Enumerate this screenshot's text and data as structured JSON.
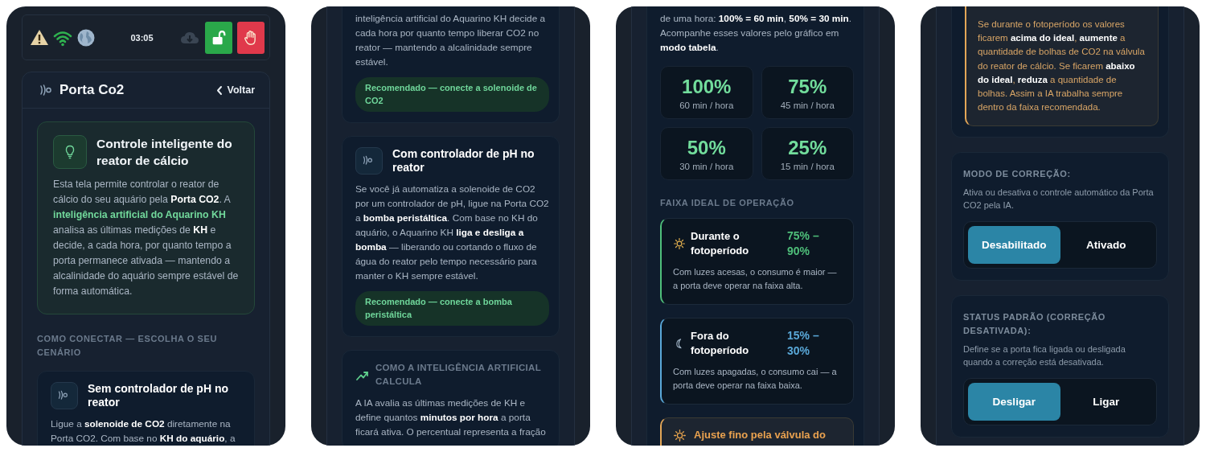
{
  "screens": [
    {
      "status_bar": {
        "time": "03:05"
      },
      "header": {
        "title": "Porta Co2",
        "back_label": "Voltar"
      },
      "blocks": [
        {
          "kind": "intro",
          "title": "Controle inteligente do reator de cálcio",
          "text_parts": [
            {
              "text": "Esta tela permite controlar o reator de cálcio do seu aquário pela ",
              "kind": "plain"
            },
            {
              "text": "Porta CO2",
              "kind": "strong"
            },
            {
              "text": ". A ",
              "kind": "plain"
            },
            {
              "text": "inteligência artificial do Aquarino KH",
              "kind": "highlight"
            },
            {
              "text": " analisa as últimas medições de ",
              "kind": "plain"
            },
            {
              "text": "KH",
              "kind": "strong"
            },
            {
              "text": " e decide, a cada hora, por quanto tempo a porta permanece ativada — mantendo a alcalinidade do aquário sempre estável de forma automática.",
              "kind": "plain"
            }
          ]
        },
        {
          "kind": "label",
          "text": "COMO CONECTAR — ESCOLHA O SEU CENÁRIO"
        },
        {
          "kind": "scenario",
          "continued": false,
          "title": "Sem controlador de pH no reator",
          "text": "Ligue a **solenoide de CO2** diretamente na Porta CO2. Com base no **KH do aquário**, a"
        }
      ]
    },
    {
      "blocks": [
        {
          "kind": "scenario",
          "continued": true,
          "text": "inteligência artificial do Aquarino KH decide a cada hora por quanto tempo liberar CO2 no reator — mantendo a alcalinidade sempre estável.",
          "badge": "Recomendado — conecte a solenoide de CO2"
        },
        {
          "kind": "scenario",
          "continued": false,
          "title": "Com controlador de pH no reator",
          "text": "Se você já automatiza a solenoide de CO2 por um controlador de pH, ligue na Porta CO2 a **bomba peristáltica**. Com base no KH do aquário, o Aquarino KH **liga e desliga a bomba** — liberando ou cortando o fluxo de água do reator pelo tempo necessário para manter o KH sempre estável.",
          "badge": "Recomendado — conecte a bomba peristáltica"
        },
        {
          "kind": "box",
          "continued": false,
          "heading": "COMO A INTELIGÊNCIA ARTIFICIAL CALCULA",
          "children": [
            {
              "kind": "text",
              "text": "A IA avalia as últimas medições de KH e define quantos **minutos por hora** a porta ficará ativa. O percentual representa a fração"
            }
          ]
        }
      ]
    },
    {
      "blocks": [
        {
          "kind": "box",
          "continued": true,
          "children": [
            {
              "kind": "text",
              "text": "de uma hora: **100% = 60 min**, **50% = 30 min**. Acompanhe esses valores pelo gráfico em **modo tabela**."
            },
            {
              "kind": "stats",
              "items": [
                {
                  "value": "100%",
                  "caption": "60 min / hora"
                },
                {
                  "value": "75%",
                  "caption": "45 min / hora"
                },
                {
                  "value": "50%",
                  "caption": "30 min / hora"
                },
                {
                  "value": "25%",
                  "caption": "15 min / hora"
                }
              ]
            },
            {
              "kind": "label",
              "text": "FAIXA IDEAL DE OPERAÇÃO"
            },
            {
              "kind": "daytime",
              "title": "Durante o fotoperíodo",
              "value": "75% – 90%",
              "color": "#4fbf7a",
              "text": "Com luzes acesas, o consumo é maior — a porta deve operar na faixa alta."
            },
            {
              "kind": "nighttime",
              "title": "Fora do fotoperíodo",
              "value": "15% – 30%",
              "color": "#5aa8d8",
              "text": "Com luzes apagadas, o consumo cai — a porta deve operar na faixa baixa."
            },
            {
              "kind": "note",
              "continued": false,
              "title": "Ajuste fino pela válvula do"
            }
          ]
        }
      ]
    },
    {
      "blocks": [
        {
          "kind": "box",
          "continued": true,
          "children": [
            {
              "kind": "note",
              "continued": true,
              "text": "Se durante o fotoperíodo os valores ficarem **acima do ideal**, **aumente** a quantidade de bolhas de CO2 na válvula do reator de cálcio. Se ficarem **abaixo do ideal**, **reduza** a quantidade de bolhas. Assim a IA trabalha sempre dentro da faixa recomendada."
            }
          ]
        },
        {
          "kind": "setting",
          "label": "MODO DE CORREÇÃO:",
          "text": "Ativa ou desativa o controle automático da Porta CO2 pela IA.",
          "options": [
            {
              "label": "Desabilitado",
              "selected": true
            },
            {
              "label": "Ativado",
              "selected": false
            }
          ]
        },
        {
          "kind": "setting",
          "label": "STATUS PADRÃO (CORREÇÃO DESATIVADA):",
          "text": "Define se a porta fica ligada ou desligada quando a correção está desativada.",
          "options": [
            {
              "label": "Desligar",
              "selected": true
            },
            {
              "label": "Ligar",
              "selected": false
            }
          ]
        }
      ]
    }
  ]
}
